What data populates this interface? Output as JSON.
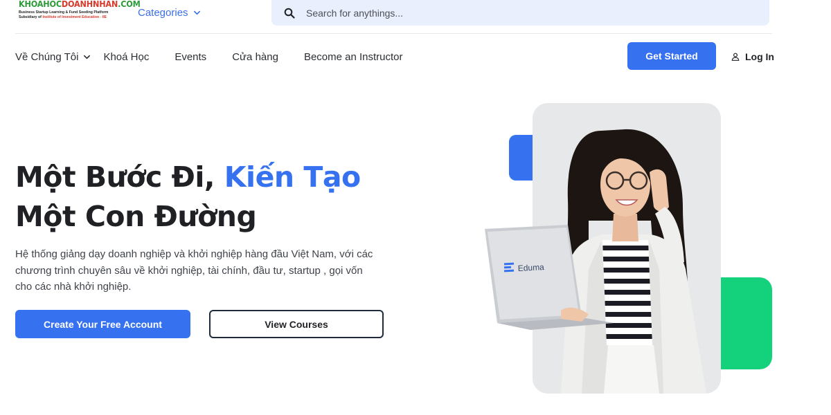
{
  "logo": {
    "main_a": "KHOAHOC",
    "main_b": "DOANHNHAN",
    "main_c": ".COM",
    "tagline": "Business Startup Learning  & Fund Seeding Platform",
    "subsidiary_prefix": "Subsidiary of ",
    "subsidiary_name": "Institute of Investment Education - IIE"
  },
  "header": {
    "categories_label": "Categories",
    "search_placeholder": "Search for anythings..."
  },
  "nav": {
    "items": [
      {
        "label": "Về Chúng Tôi",
        "has_dropdown": true
      },
      {
        "label": "Khoá Học"
      },
      {
        "label": "Events"
      },
      {
        "label": "Cửa hàng"
      },
      {
        "label": "Become an Instructor"
      }
    ],
    "get_started": "Get Started",
    "login": "Log In"
  },
  "hero": {
    "title_line1_part1": "Một Bước Đi, ",
    "title_line1_accent": "Kiến Tạo",
    "title_line2": "Một Con Đường",
    "description": "Hệ thống giảng dạy doanh nghiệp và khởi nghiệp hàng đầu Việt Nam, với các chương trình chuyên sâu về khởi nghiệp, tài chính, đầu tư, startup , gọi vốn cho các nhà khởi nghiệp.",
    "cta_primary": "Create Your Free Account",
    "cta_secondary": "View Courses",
    "laptop_brand": "Eduma"
  },
  "colors": {
    "accent_blue": "#3671f0",
    "accent_green": "#14d17b",
    "logo_green": "#2e9b3a",
    "logo_red": "#d83a2b",
    "search_bg": "#e9effc"
  },
  "icons": {
    "search": "search-icon",
    "chevron": "chevron-down-icon",
    "user": "user-icon"
  }
}
